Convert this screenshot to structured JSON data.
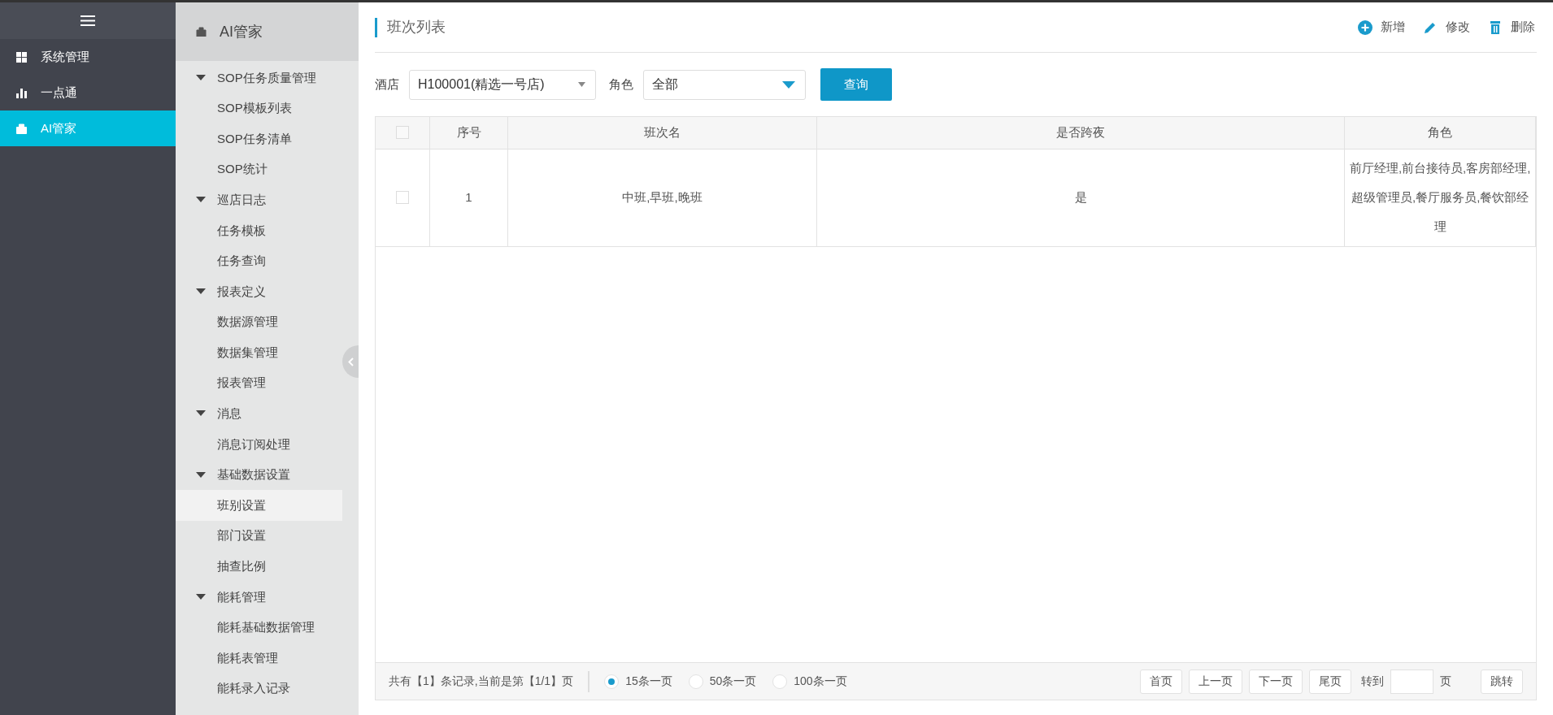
{
  "nav": {
    "items": [
      {
        "label": "系统管理",
        "kind": "grid",
        "selected": false
      },
      {
        "label": "一点通",
        "kind": "bars",
        "selected": false
      },
      {
        "label": "AI管家",
        "kind": "bag",
        "selected": true
      }
    ]
  },
  "submenu": {
    "title": "AI管家",
    "groups": [
      {
        "label": "SOP任务质量管理",
        "expanded": true,
        "children": [
          {
            "label": "SOP模板列表",
            "selected": false
          },
          {
            "label": "SOP任务清单",
            "selected": false
          },
          {
            "label": "SOP统计",
            "selected": false
          }
        ]
      },
      {
        "label": "巡店日志",
        "expanded": true,
        "children": [
          {
            "label": "任务模板",
            "selected": false
          },
          {
            "label": "任务查询",
            "selected": false
          }
        ]
      },
      {
        "label": "报表定义",
        "expanded": true,
        "children": [
          {
            "label": "数据源管理",
            "selected": false
          },
          {
            "label": "数据集管理",
            "selected": false
          },
          {
            "label": "报表管理",
            "selected": false
          }
        ]
      },
      {
        "label": "消息",
        "expanded": true,
        "children": [
          {
            "label": "消息订阅处理",
            "selected": false
          }
        ]
      },
      {
        "label": "基础数据设置",
        "expanded": true,
        "children": [
          {
            "label": "班别设置",
            "selected": true
          },
          {
            "label": "部门设置",
            "selected": false
          },
          {
            "label": "抽查比例",
            "selected": false
          }
        ]
      },
      {
        "label": "能耗管理",
        "expanded": true,
        "children": [
          {
            "label": "能耗基础数据管理",
            "selected": false
          },
          {
            "label": "能耗表管理",
            "selected": false
          },
          {
            "label": "能耗录入记录",
            "selected": false
          }
        ]
      }
    ]
  },
  "page": {
    "title": "班次列表",
    "actions": [
      {
        "label": "新增",
        "kind": "add"
      },
      {
        "label": "修改",
        "kind": "edit"
      },
      {
        "label": "删除",
        "kind": "delete"
      }
    ]
  },
  "filters": [
    {
      "label": "酒店",
      "value": "H100001(精选一号店)",
      "kind": "plain"
    },
    {
      "label": "角色",
      "value": "全部",
      "kind": "accent"
    }
  ],
  "query_button": "查询",
  "table": {
    "select_all_checked": false,
    "columns": [
      "序号",
      "班次名",
      "是否跨夜",
      "角色"
    ],
    "rows": [
      {
        "checked": false,
        "cells": [
          "1",
          "中班,早班,晚班",
          "是",
          "前厅经理,前台接待员,客房部经理,超级管理员,餐厅服务员,餐饮部经理"
        ]
      }
    ]
  },
  "footer": {
    "summary": "共有【1】条记录,当前是第【1/1】页",
    "page_sizes": [
      {
        "label": "15条一页",
        "selected": true
      },
      {
        "label": "50条一页",
        "selected": false
      },
      {
        "label": "100条一页",
        "selected": false
      }
    ],
    "nav_buttons": [
      "首页",
      "上一页",
      "下一页",
      "尾页"
    ],
    "goto_label": "转到",
    "goto_unit": "页",
    "jump_button": "跳转"
  }
}
